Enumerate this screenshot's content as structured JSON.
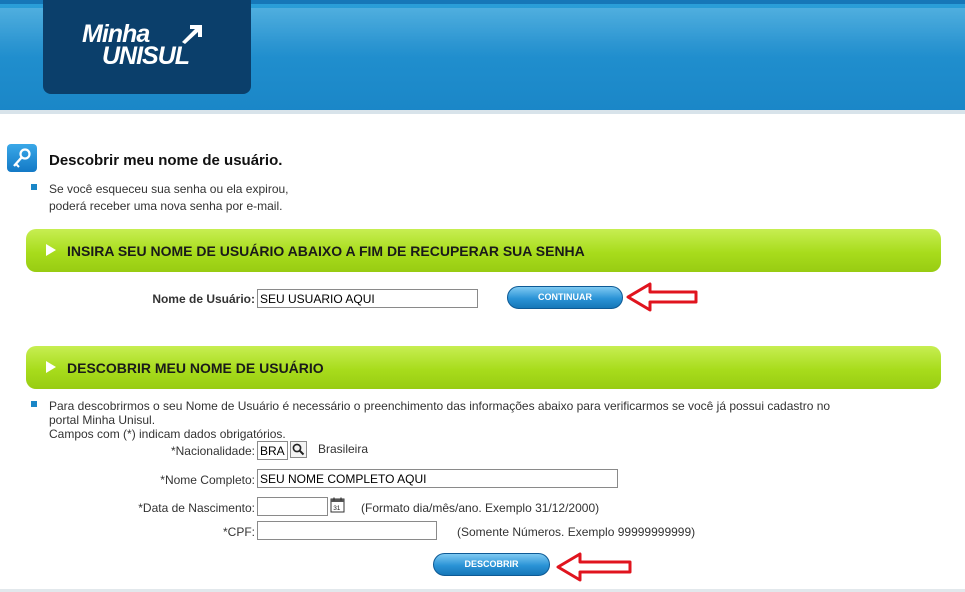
{
  "header": {
    "logo_line1": "Minha",
    "logo_line2": "UNISUL"
  },
  "page": {
    "title": "Descobrir meu nome de usuário.",
    "intro_line1": "Se você esqueceu sua senha ou ela expirou,",
    "intro_line2": "poderá receber uma nova senha por e-mail."
  },
  "section1": {
    "header": "INSIRA SEU NOME DE USUÁRIO ABAIXO A FIM DE RECUPERAR SUA SENHA",
    "username_label": "Nome de Usuário:",
    "username_value": "SEU USUARIO AQUI",
    "continue_button": "CONTINUAR"
  },
  "section2": {
    "header": "DESCOBRIR MEU NOME DE USUÁRIO",
    "info_line1": "Para descobrirmos o seu Nome de Usuário é necessário o preenchimento das informações abaixo para verificarmos se você já possui cadastro no",
    "info_line2": "portal Minha Unisul.",
    "info_line3": "Campos com (*) indicam dados obrigatórios.",
    "nationality_label": "*Nacionalidade:",
    "nationality_value": "BRA",
    "nationality_text": "Brasileira",
    "fullname_label": "*Nome Completo:",
    "fullname_value": "SEU NOME COMPLETO AQUI",
    "birthdate_label": "*Data de Nascimento:",
    "birthdate_value": "",
    "birthdate_hint": "(Formato dia/mês/ano. Exemplo 31/12/2000)",
    "cpf_label": "*CPF:",
    "cpf_value": "",
    "cpf_hint": "(Somente Números. Exemplo 99999999999)",
    "discover_button": "DESCOBRIR"
  },
  "colors": {
    "header_blue": "#2190cf",
    "logo_navy": "#0b3f6b",
    "green_bar": "#a8dc1c",
    "annotation_red": "#e0141e"
  }
}
